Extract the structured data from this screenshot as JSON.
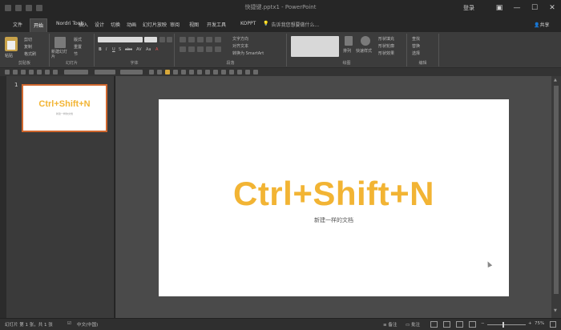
{
  "titlebar": {
    "title": "快捷键.pptx1 - PowerPoint",
    "login_label": "登录",
    "ribbon_display_icon": "ribbon-display-icon",
    "minimize_glyph": "—",
    "maximize_glyph": "☐",
    "close_glyph": "✕"
  },
  "tabs": [
    {
      "label": "文件",
      "active": false
    },
    {
      "label": "开始",
      "active": true
    },
    {
      "label": "Nordri Tools",
      "active": false
    },
    {
      "label": "插入",
      "active": false
    },
    {
      "label": "设计",
      "active": false
    },
    {
      "label": "切换",
      "active": false
    },
    {
      "label": "动画",
      "active": false
    },
    {
      "label": "幻灯片放映",
      "active": false
    },
    {
      "label": "审阅",
      "active": false
    },
    {
      "label": "视图",
      "active": false
    },
    {
      "label": "开发工具",
      "active": false
    },
    {
      "label": "KOPPT",
      "active": false
    }
  ],
  "tell_me": "告诉我您想要做什么...",
  "share_label": "共享",
  "ribbon": {
    "groups": [
      {
        "name": "clipboard",
        "label": "剪贴板",
        "items": [
          "粘贴",
          "剪切",
          "复制",
          "格式刷"
        ]
      },
      {
        "name": "slides",
        "label": "幻灯片",
        "items": [
          "新建幻灯片",
          "版式",
          "重置",
          "节"
        ]
      },
      {
        "name": "font",
        "label": "字体",
        "items": [
          "B",
          "I",
          "U",
          "S",
          "abc",
          "AV",
          "Aa",
          "A"
        ]
      },
      {
        "name": "paragraph",
        "label": "段落",
        "items": [
          "文字方向",
          "对齐文本",
          "转换为 SmartArt"
        ]
      },
      {
        "name": "drawing",
        "label": "绘图",
        "items": [
          "排列",
          "快速样式",
          "形状填充",
          "形状轮廓",
          "形状效果"
        ]
      },
      {
        "name": "editing",
        "label": "编辑",
        "items": [
          "查找",
          "替换",
          "选择"
        ]
      }
    ]
  },
  "thumbnail": {
    "number": "1",
    "title": "Ctrl+Shift+N",
    "subtitle": "新建一样的文档"
  },
  "slide": {
    "title": "Ctrl+Shift+N",
    "subtitle": "新建一样的文档"
  },
  "status": {
    "slide_info": "幻灯片 第 1 张，共 1 张",
    "language": "中文(中国)",
    "notes_label": "备注",
    "comments_label": "批注",
    "zoom": "75%"
  },
  "colors": {
    "accent_title": "#f2b434",
    "selected_thumb_border": "#d0672e"
  }
}
